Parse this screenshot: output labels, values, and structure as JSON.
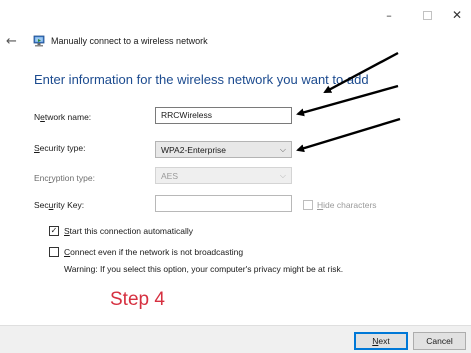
{
  "window": {
    "minimize_glyph": "–",
    "close_glyph": "✕"
  },
  "header": {
    "back_glyph": "←",
    "title": "Manually connect to a wireless network"
  },
  "heading": "Enter information for the wireless network you want to add",
  "form": {
    "network_name": {
      "label_pre": "N",
      "label_ul": "e",
      "label_post": "twork name:",
      "value": "RRCWireless"
    },
    "security_type": {
      "label_pre": "",
      "label_ul": "S",
      "label_post": "ecurity type:",
      "value": "WPA2-Enterprise"
    },
    "encryption_type": {
      "label_pre": "Enc",
      "label_ul": "r",
      "label_post": "yption type:",
      "value": "AES"
    },
    "security_key": {
      "label_pre": "Sec",
      "label_ul": "u",
      "label_post": "rity Key:",
      "value": ""
    },
    "hide_characters": {
      "label_ul": "H",
      "label_post": "ide characters",
      "checked": false
    }
  },
  "options": {
    "start_auto": {
      "label_ul": "S",
      "label_post": "tart this connection automatically",
      "checked": true
    },
    "connect_even": {
      "label_ul": "C",
      "label_post": "onnect even if the network is not broadcasting",
      "checked": false
    },
    "warning": "Warning: If you select this option, your computer's privacy might be at risk."
  },
  "annotation": "Step 4",
  "footer": {
    "next_ul": "N",
    "next_post": "ext",
    "cancel": "Cancel"
  },
  "colors": {
    "heading": "#1c4b8f",
    "annotation": "#d63040",
    "arrow": "#000000"
  }
}
